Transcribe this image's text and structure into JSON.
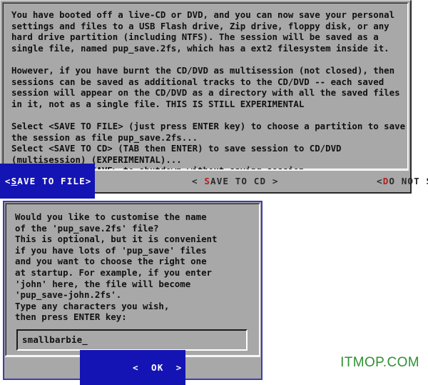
{
  "dialogs": {
    "save_session": {
      "name": "save-session-dialog",
      "message_lines": [
        "You have booted off a live-CD or DVD, and you can now save your personal",
        "settings and files to a USB Flash drive, Zip drive, floppy disk, or any",
        "hard drive partition (including NTFS). The session will be saved as a",
        "single file, named pup_save.2fs, which has a ext2 filesystem inside it.",
        "",
        "However, if you have burnt the CD/DVD as multisession (not closed), then",
        "sessions can be saved as additional tracks to the CD/DVD -- each saved",
        "session will appear on the CD/DVD as a directory with all the saved files",
        "in it, not as a single file. THIS IS STILL EXPERIMENTAL",
        "",
        "Select <SAVE TO FILE> (just press ENTER key) to choose a partition to save",
        "the session as file pup_save.2fs...",
        "Select <SAVE TO CD> (TAB then ENTER) to save session to CD/DVD",
        "(multisession) (EXPERIMENTAL)...",
        "Select <DO NOT SAVE> to shutdown without saving session..."
      ],
      "buttons": [
        {
          "id": "save-to-file",
          "open_bracket": "<",
          "hotkey": "S",
          "rest": "AVE TO FILE",
          "close_bracket": ">",
          "selected": true
        },
        {
          "id": "save-to-cd",
          "open_bracket": "< ",
          "hotkey": "S",
          "rest": "AVE TO CD",
          "close_bracket": " >",
          "selected": false
        },
        {
          "id": "do-not-save",
          "open_bracket": "<",
          "hotkey": "D",
          "rest": "O NOT SAVE",
          "close_bracket": " >",
          "selected": false
        }
      ]
    },
    "customise_name": {
      "name": "customise-name-dialog",
      "message_lines": [
        "Would you like to customise the name",
        "of the 'pup_save.2fs' file?",
        "This is optional, but it is convenient",
        "if you have lots of 'pup_save' files",
        "and you want to choose the right one",
        "at startup. For example, if you enter",
        "'john' here, the file will become",
        "'pup_save-john.2fs'.",
        "Type any characters you wish,",
        "then press ENTER key:"
      ],
      "input": {
        "value": "smallbarbie_",
        "placeholder": ""
      },
      "buttons": [
        {
          "id": "ok",
          "open_bracket": "< ",
          "hotkey": "",
          "rest": " OK ",
          "close_bracket": " >",
          "selected": true
        }
      ]
    }
  },
  "watermark": {
    "text": "ITMOP.COM"
  },
  "colors": {
    "dialog_background": "#a8a8a8",
    "selected_button_background": "#1414b4",
    "selected_button_text": "#ffffff",
    "hotkey_red": "#b02020",
    "focused_border_blue": "#3d3dad",
    "watermark_green": "#2e9130",
    "page_background": "#ffffff"
  }
}
